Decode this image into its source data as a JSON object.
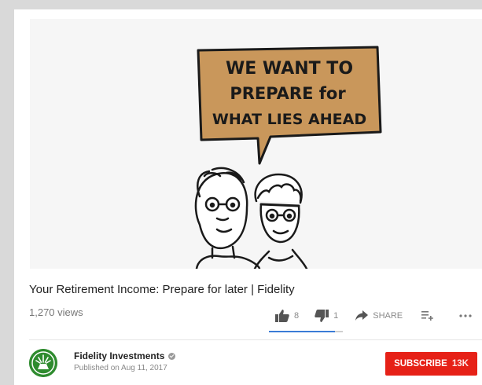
{
  "video": {
    "bubble_lines": [
      "WE WANT TO",
      "PREPARE for",
      "WHAT LIES AHEAD"
    ],
    "colors": {
      "bubble": "#c9975b",
      "ink": "#1a1a1a",
      "background": "#f6f6f6"
    }
  },
  "title": "Your Retirement Income: Prepare for later | Fidelity",
  "views": "1,270 views",
  "actions": {
    "likes": "8",
    "dislikes": "1",
    "share_label": "SHARE",
    "like_ratio": 0.89,
    "like_bar_color": "#3b7cd6",
    "icons": [
      "thumbs-up-icon",
      "thumbs-down-icon",
      "share-arrow-icon",
      "add-to-playlist-icon",
      "more-icon"
    ]
  },
  "channel": {
    "name": "Fidelity Investments",
    "published": "Published on Aug 11, 2017",
    "avatar_color": "#2e8b2e"
  },
  "subscribe": {
    "label": "SUBSCRIBE",
    "count": "13K",
    "color": "#e62117"
  }
}
